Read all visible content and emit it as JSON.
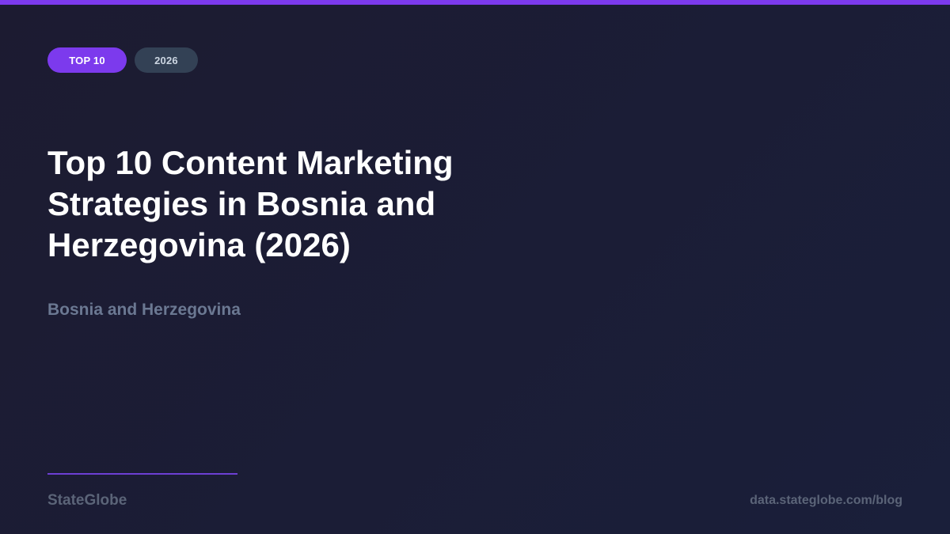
{
  "badges": {
    "primary": "TOP 10",
    "year": "2026"
  },
  "title": "Top 10 Content Marketing Strategies in Bosnia and Herzegovina (2026)",
  "subtitle": "Bosnia and Herzegovina",
  "footer": {
    "brand": "StateGlobe",
    "url": "data.stateglobe.com/blog"
  },
  "colors": {
    "accent": "#7c3aed",
    "background": "#1c1b31",
    "badge_secondary": "#334155",
    "muted_text": "#6b7892"
  }
}
